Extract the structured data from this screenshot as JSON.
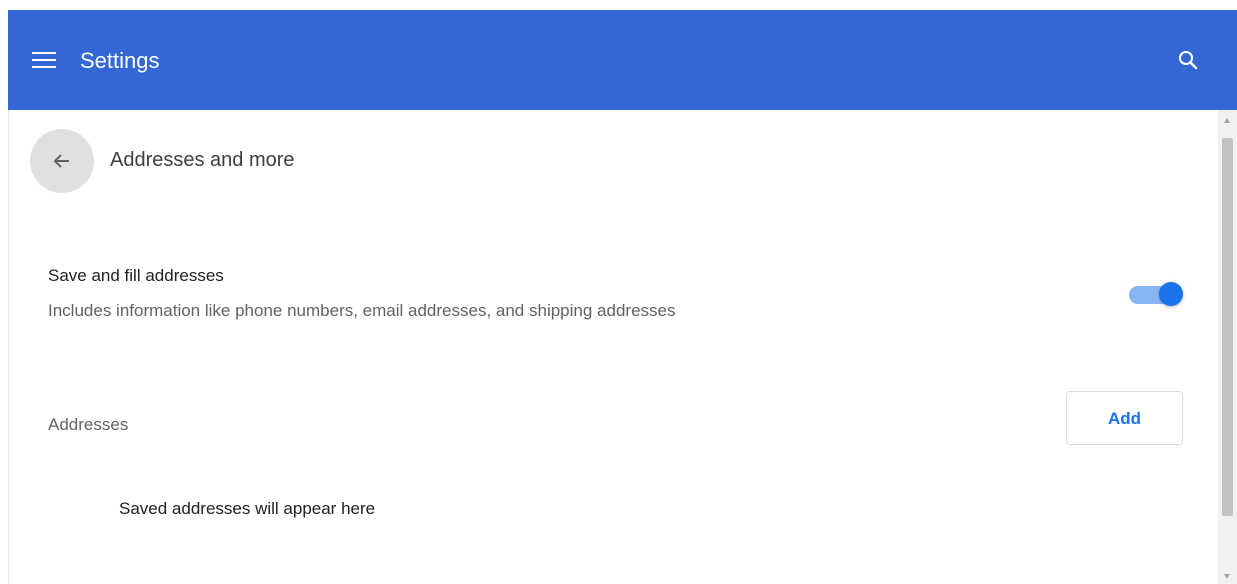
{
  "toolbar": {
    "title": "Settings",
    "menu_icon": "hamburger-menu-icon",
    "search_icon": "search-icon",
    "background_color": "#3367d6"
  },
  "page": {
    "title": "Addresses and more",
    "back_icon": "arrow-left-icon"
  },
  "save_fill": {
    "title": "Save and fill addresses",
    "description": "Includes information like phone numbers, email addresses, and shipping addresses",
    "enabled": true,
    "accent_color": "#1a73e8"
  },
  "addresses": {
    "label": "Addresses",
    "add_button_label": "Add",
    "empty_text": "Saved addresses will appear here"
  }
}
